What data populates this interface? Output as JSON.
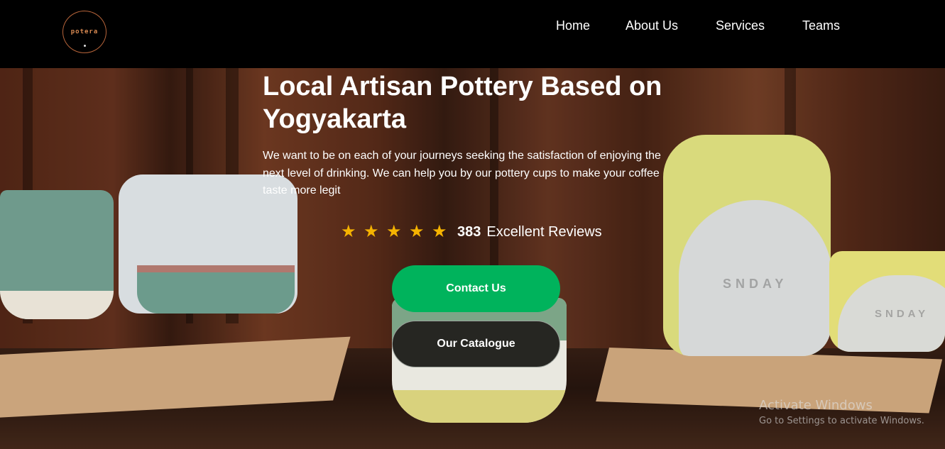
{
  "header": {
    "logo_text": "potera",
    "nav": [
      "Home",
      "About Us",
      "Services",
      "Teams"
    ]
  },
  "hero": {
    "headline": "Local Artisan Pottery Based on Yogyakarta",
    "description": "We want to be on each of your journeys seeking the satisfaction of enjoying the next level of drinking. We can help you by our pottery cups to make your coffee taste more legit",
    "rating": {
      "stars": 5,
      "star_color": "#f5b301",
      "count": "383",
      "label": "Excellent Reviews"
    },
    "buttons": {
      "contact": "Contact Us",
      "catalogue": "Our Catalogue"
    },
    "cup_marks": [
      "SNDAY",
      "SNDAY"
    ],
    "accent_color": "#00b35c"
  },
  "watermark": {
    "title": "Activate Windows",
    "subtitle": "Go to Settings to activate Windows."
  }
}
